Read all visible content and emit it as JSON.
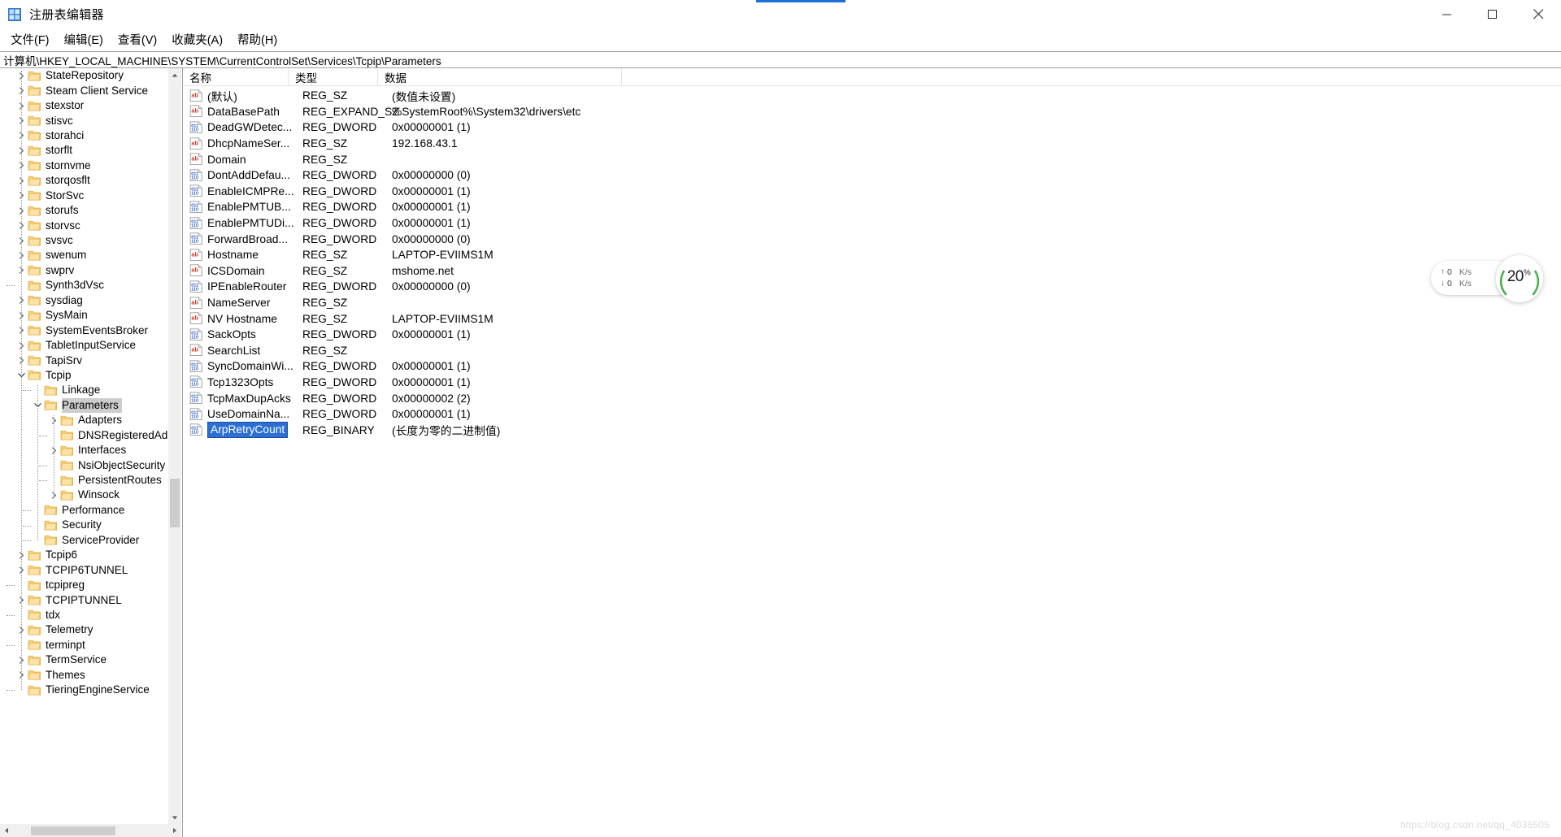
{
  "window": {
    "title": "注册表编辑器",
    "app_icon": "registry-editor-icon",
    "minimize_label": "最小化",
    "maximize_label": "最大化",
    "close_label": "关闭"
  },
  "menubar": {
    "items": [
      {
        "label": "文件(F)",
        "name": "menu-file"
      },
      {
        "label": "编辑(E)",
        "name": "menu-edit"
      },
      {
        "label": "查看(V)",
        "name": "menu-view"
      },
      {
        "label": "收藏夹(A)",
        "name": "menu-favorites"
      },
      {
        "label": "帮助(H)",
        "name": "menu-help"
      }
    ]
  },
  "address": {
    "path": "计算机\\HKEY_LOCAL_MACHINE\\SYSTEM\\CurrentControlSet\\Services\\Tcpip\\Parameters"
  },
  "tree": {
    "nodes": [
      {
        "label": "StateRepository",
        "depth": 1,
        "twist": "right",
        "selected": false
      },
      {
        "label": "Steam Client Service",
        "depth": 1,
        "twist": "right",
        "selected": false
      },
      {
        "label": "stexstor",
        "depth": 1,
        "twist": "right",
        "selected": false
      },
      {
        "label": "stisvc",
        "depth": 1,
        "twist": "right",
        "selected": false
      },
      {
        "label": "storahci",
        "depth": 1,
        "twist": "right",
        "selected": false
      },
      {
        "label": "storflt",
        "depth": 1,
        "twist": "right",
        "selected": false
      },
      {
        "label": "stornvme",
        "depth": 1,
        "twist": "right",
        "selected": false
      },
      {
        "label": "storqosflt",
        "depth": 1,
        "twist": "right",
        "selected": false
      },
      {
        "label": "StorSvc",
        "depth": 1,
        "twist": "right",
        "selected": false
      },
      {
        "label": "storufs",
        "depth": 1,
        "twist": "right",
        "selected": false
      },
      {
        "label": "storvsc",
        "depth": 1,
        "twist": "right",
        "selected": false
      },
      {
        "label": "svsvc",
        "depth": 1,
        "twist": "right",
        "selected": false
      },
      {
        "label": "swenum",
        "depth": 1,
        "twist": "right",
        "selected": false
      },
      {
        "label": "swprv",
        "depth": 1,
        "twist": "right",
        "selected": false
      },
      {
        "label": "Synth3dVsc",
        "depth": 1,
        "twist": "none",
        "selected": false
      },
      {
        "label": "sysdiag",
        "depth": 1,
        "twist": "right",
        "selected": false
      },
      {
        "label": "SysMain",
        "depth": 1,
        "twist": "right",
        "selected": false
      },
      {
        "label": "SystemEventsBroker",
        "depth": 1,
        "twist": "right",
        "selected": false
      },
      {
        "label": "TabletInputService",
        "depth": 1,
        "twist": "right",
        "selected": false
      },
      {
        "label": "TapiSrv",
        "depth": 1,
        "twist": "right",
        "selected": false
      },
      {
        "label": "Tcpip",
        "depth": 1,
        "twist": "down",
        "selected": false
      },
      {
        "label": "Linkage",
        "depth": 2,
        "twist": "none",
        "selected": false
      },
      {
        "label": "Parameters",
        "depth": 2,
        "twist": "down",
        "selected": true
      },
      {
        "label": "Adapters",
        "depth": 3,
        "twist": "right",
        "selected": false
      },
      {
        "label": "DNSRegisteredAdapters",
        "depth": 3,
        "twist": "none",
        "selected": false
      },
      {
        "label": "Interfaces",
        "depth": 3,
        "twist": "right",
        "selected": false
      },
      {
        "label": "NsiObjectSecurity",
        "depth": 3,
        "twist": "none",
        "selected": false
      },
      {
        "label": "PersistentRoutes",
        "depth": 3,
        "twist": "none",
        "selected": false
      },
      {
        "label": "Winsock",
        "depth": 3,
        "twist": "right",
        "selected": false
      },
      {
        "label": "Performance",
        "depth": 2,
        "twist": "none",
        "selected": false
      },
      {
        "label": "Security",
        "depth": 2,
        "twist": "none",
        "selected": false
      },
      {
        "label": "ServiceProvider",
        "depth": 2,
        "twist": "none",
        "selected": false
      },
      {
        "label": "Tcpip6",
        "depth": 1,
        "twist": "right",
        "selected": false
      },
      {
        "label": "TCPIP6TUNNEL",
        "depth": 1,
        "twist": "right",
        "selected": false
      },
      {
        "label": "tcpipreg",
        "depth": 1,
        "twist": "none",
        "selected": false
      },
      {
        "label": "TCPIPTUNNEL",
        "depth": 1,
        "twist": "right",
        "selected": false
      },
      {
        "label": "tdx",
        "depth": 1,
        "twist": "none",
        "selected": false
      },
      {
        "label": "Telemetry",
        "depth": 1,
        "twist": "right",
        "selected": false
      },
      {
        "label": "terminpt",
        "depth": 1,
        "twist": "none",
        "selected": false
      },
      {
        "label": "TermService",
        "depth": 1,
        "twist": "right",
        "selected": false
      },
      {
        "label": "Themes",
        "depth": 1,
        "twist": "right",
        "selected": false
      },
      {
        "label": "TieringEngineService",
        "depth": 1,
        "twist": "none",
        "selected": false
      }
    ]
  },
  "list": {
    "columns": [
      {
        "label": "名称",
        "name": "column-name"
      },
      {
        "label": "类型",
        "name": "column-type"
      },
      {
        "label": "数据",
        "name": "column-data"
      }
    ],
    "rows": [
      {
        "name": "(默认)",
        "icon": "string-value-icon",
        "type": "REG_SZ",
        "data": "(数值未设置)",
        "editing": false
      },
      {
        "name": "DataBasePath",
        "icon": "string-value-icon",
        "type": "REG_EXPAND_SZ",
        "data": "%SystemRoot%\\System32\\drivers\\etc",
        "editing": false
      },
      {
        "name": "DeadGWDetec...",
        "icon": "binary-value-icon",
        "type": "REG_DWORD",
        "data": "0x00000001 (1)",
        "editing": false
      },
      {
        "name": "DhcpNameSer...",
        "icon": "string-value-icon",
        "type": "REG_SZ",
        "data": "192.168.43.1",
        "editing": false
      },
      {
        "name": "Domain",
        "icon": "string-value-icon",
        "type": "REG_SZ",
        "data": "",
        "editing": false
      },
      {
        "name": "DontAddDefau...",
        "icon": "binary-value-icon",
        "type": "REG_DWORD",
        "data": "0x00000000 (0)",
        "editing": false
      },
      {
        "name": "EnableICMPRe...",
        "icon": "binary-value-icon",
        "type": "REG_DWORD",
        "data": "0x00000001 (1)",
        "editing": false
      },
      {
        "name": "EnablePMTUB...",
        "icon": "binary-value-icon",
        "type": "REG_DWORD",
        "data": "0x00000001 (1)",
        "editing": false
      },
      {
        "name": "EnablePMTUDi...",
        "icon": "binary-value-icon",
        "type": "REG_DWORD",
        "data": "0x00000001 (1)",
        "editing": false
      },
      {
        "name": "ForwardBroad...",
        "icon": "binary-value-icon",
        "type": "REG_DWORD",
        "data": "0x00000000 (0)",
        "editing": false
      },
      {
        "name": "Hostname",
        "icon": "string-value-icon",
        "type": "REG_SZ",
        "data": "LAPTOP-EVIIMS1M",
        "editing": false
      },
      {
        "name": "ICSDomain",
        "icon": "string-value-icon",
        "type": "REG_SZ",
        "data": "mshome.net",
        "editing": false
      },
      {
        "name": "IPEnableRouter",
        "icon": "binary-value-icon",
        "type": "REG_DWORD",
        "data": "0x00000000 (0)",
        "editing": false
      },
      {
        "name": "NameServer",
        "icon": "string-value-icon",
        "type": "REG_SZ",
        "data": "",
        "editing": false
      },
      {
        "name": "NV Hostname",
        "icon": "string-value-icon",
        "type": "REG_SZ",
        "data": "LAPTOP-EVIIMS1M",
        "editing": false
      },
      {
        "name": "SackOpts",
        "icon": "binary-value-icon",
        "type": "REG_DWORD",
        "data": "0x00000001 (1)",
        "editing": false
      },
      {
        "name": "SearchList",
        "icon": "string-value-icon",
        "type": "REG_SZ",
        "data": "",
        "editing": false
      },
      {
        "name": "SyncDomainWi...",
        "icon": "binary-value-icon",
        "type": "REG_DWORD",
        "data": "0x00000001 (1)",
        "editing": false
      },
      {
        "name": "Tcp1323Opts",
        "icon": "binary-value-icon",
        "type": "REG_DWORD",
        "data": "0x00000001 (1)",
        "editing": false
      },
      {
        "name": "TcpMaxDupAcks",
        "icon": "binary-value-icon",
        "type": "REG_DWORD",
        "data": "0x00000002 (2)",
        "editing": false
      },
      {
        "name": "UseDomainNa...",
        "icon": "binary-value-icon",
        "type": "REG_DWORD",
        "data": "0x00000001 (1)",
        "editing": false
      },
      {
        "name": "ArpRetryCount",
        "icon": "binary-value-icon",
        "type": "REG_BINARY",
        "data": "(长度为零的二进制值)",
        "editing": true
      }
    ]
  },
  "net_widget": {
    "upload_arrow": "↑",
    "upload_value": "0",
    "upload_unit": "K/s",
    "download_arrow": "↓",
    "download_value": "0",
    "download_unit": "K/s",
    "percent_value": "20",
    "percent_symbol": "%",
    "ring_color": "#4caf50"
  },
  "watermark": {
    "text": "https://blog.csdn.net/qq_4036505"
  }
}
